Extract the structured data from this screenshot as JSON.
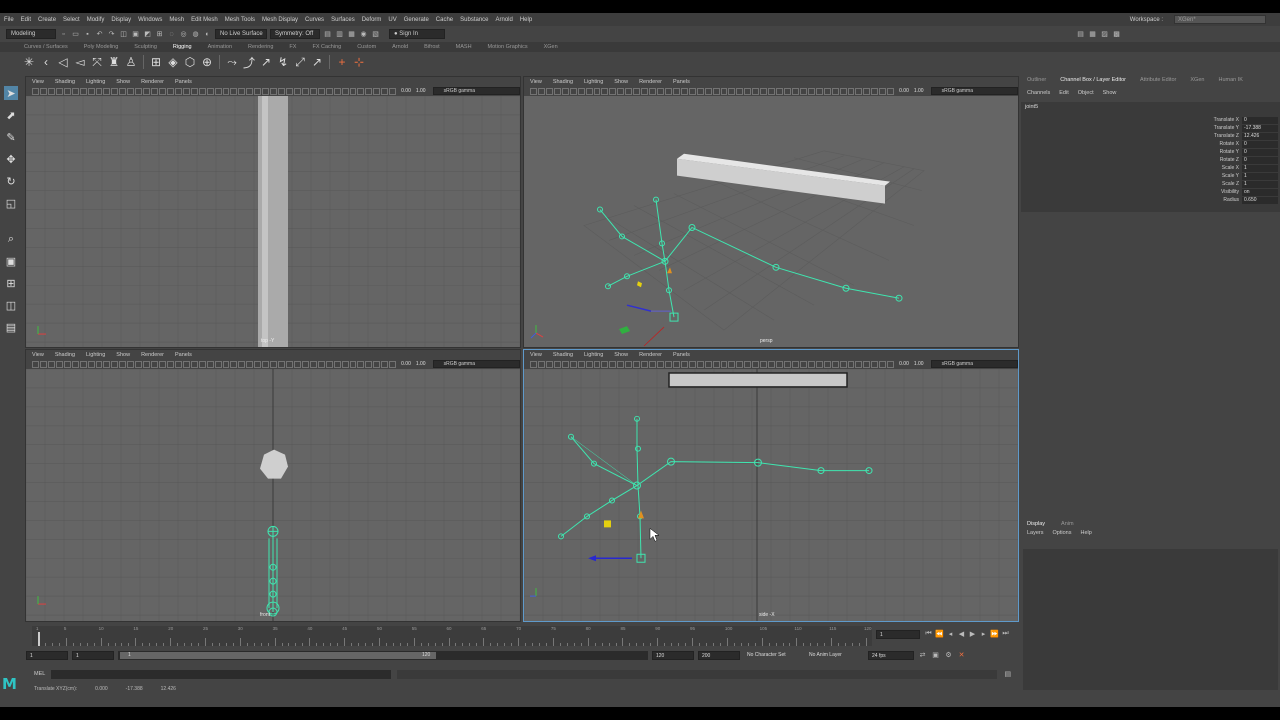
{
  "menubar": {
    "items": [
      "File",
      "Edit",
      "Create",
      "Select",
      "Modify",
      "Display",
      "Windows",
      "Mesh",
      "Edit Mesh",
      "Mesh Tools",
      "Mesh Display",
      "Curves",
      "Surfaces",
      "Deform",
      "UV",
      "Generate",
      "Cache",
      "Substance",
      "Arnold",
      "Help"
    ],
    "workspace_label": "Workspace :",
    "workspace_value": "XGen*"
  },
  "statusline": {
    "mode": "Modeling",
    "live_surface": "No Live Surface",
    "symmetry": "Symmetry: Off",
    "sign_in": "Sign In"
  },
  "shelf_tabs": [
    "Curves / Surfaces",
    "Poly Modeling",
    "Sculpting",
    "Rigging",
    "Animation",
    "Rendering",
    "FX",
    "FX Caching",
    "Custom",
    "Arnold",
    "Bifrost",
    "MASH",
    "Motion Graphics",
    "XGen"
  ],
  "shelf_active": "Rigging",
  "viewport_menu": [
    "View",
    "Shading",
    "Lighting",
    "Show",
    "Renderer",
    "Panels"
  ],
  "viewport_bar": {
    "val_a": "0.00",
    "val_b": "1.00",
    "colorspace": "sRGB gamma"
  },
  "viewports": {
    "top": {
      "label": "top -Y"
    },
    "persp": {
      "label": "persp"
    },
    "front": {
      "label": "front"
    },
    "side": {
      "label": "side -X"
    }
  },
  "right_panel": {
    "tabs": [
      "Outliner",
      "Channel Box / Layer Editor",
      "Attribute Editor",
      "XGen",
      "Human IK"
    ],
    "active_tab": "Channel Box / Layer Editor",
    "cb_menu": [
      "Channels",
      "Edit",
      "Object",
      "Show"
    ],
    "object": "joint5",
    "attributes": [
      {
        "name": "Translate X",
        "value": "0"
      },
      {
        "name": "Translate Y",
        "value": "-17.388"
      },
      {
        "name": "Translate Z",
        "value": "12.426"
      },
      {
        "name": "Rotate X",
        "value": "0"
      },
      {
        "name": "Rotate Y",
        "value": "0"
      },
      {
        "name": "Rotate Z",
        "value": "0"
      },
      {
        "name": "Scale X",
        "value": "1"
      },
      {
        "name": "Scale Y",
        "value": "1"
      },
      {
        "name": "Scale Z",
        "value": "1"
      },
      {
        "name": "Visibility",
        "value": "on"
      },
      {
        "name": "Radius",
        "value": "0.650"
      }
    ],
    "layer_tabs": [
      "Display",
      "Anim"
    ],
    "layer_menu": [
      "Layers",
      "Options",
      "Help"
    ]
  },
  "timeline": {
    "ticks": [
      "1",
      "5",
      "10",
      "15",
      "20",
      "25",
      "30",
      "35",
      "40",
      "45",
      "50",
      "55",
      "60",
      "65",
      "70",
      "75",
      "80",
      "85",
      "90",
      "95",
      "100",
      "105",
      "110",
      "115",
      "120"
    ],
    "current_frame": "1"
  },
  "rangebar": {
    "start": "1",
    "playback_start": "1",
    "slider_start": "1",
    "slider_end": "120",
    "playback_end": "120",
    "end": "200",
    "character_set": "No Character Set",
    "anim_layer": "No Anim Layer",
    "fps": "24 fps"
  },
  "cmdline": {
    "label": "MEL"
  },
  "helpline": {
    "attr": "Translate XYZ(cm):",
    "x": "0.000",
    "y": "-17.388",
    "z": "12.426"
  },
  "colors": {
    "joint": "#3fe6b0",
    "accent": "#5f9acb",
    "logo": "#2fc4c4"
  }
}
